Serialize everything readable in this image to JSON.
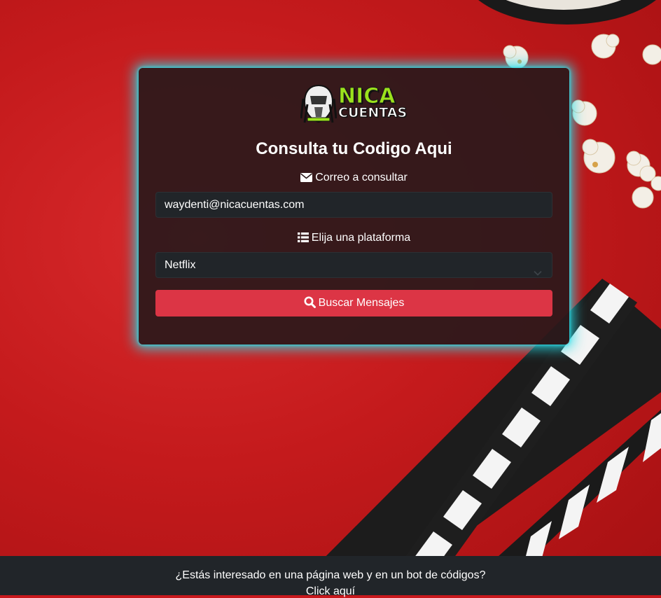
{
  "brand": {
    "logo_line1": "NICA",
    "logo_line2": "CUENTAS",
    "logo_icon": "predator-mask-icon"
  },
  "form": {
    "title": "Consulta tu Codigo Aqui",
    "email_label": "Correo a consultar",
    "email_icon": "envelope-icon",
    "email_value": "waydenti@nicacuentas.com",
    "platform_label": "Elija una plataforma",
    "platform_icon": "list-icon",
    "platform_selected": "Netflix",
    "search_button": "Buscar Mensajes",
    "search_icon": "search-icon"
  },
  "footer": {
    "line1": "¿Estás interesado en una página web y en un bot de códigos?",
    "link": "Click aquí"
  },
  "colors": {
    "accent_button": "#dc3545",
    "card_glow": "#28dce6",
    "logo_green": "#9be21c",
    "footer_bg": "#212529"
  }
}
